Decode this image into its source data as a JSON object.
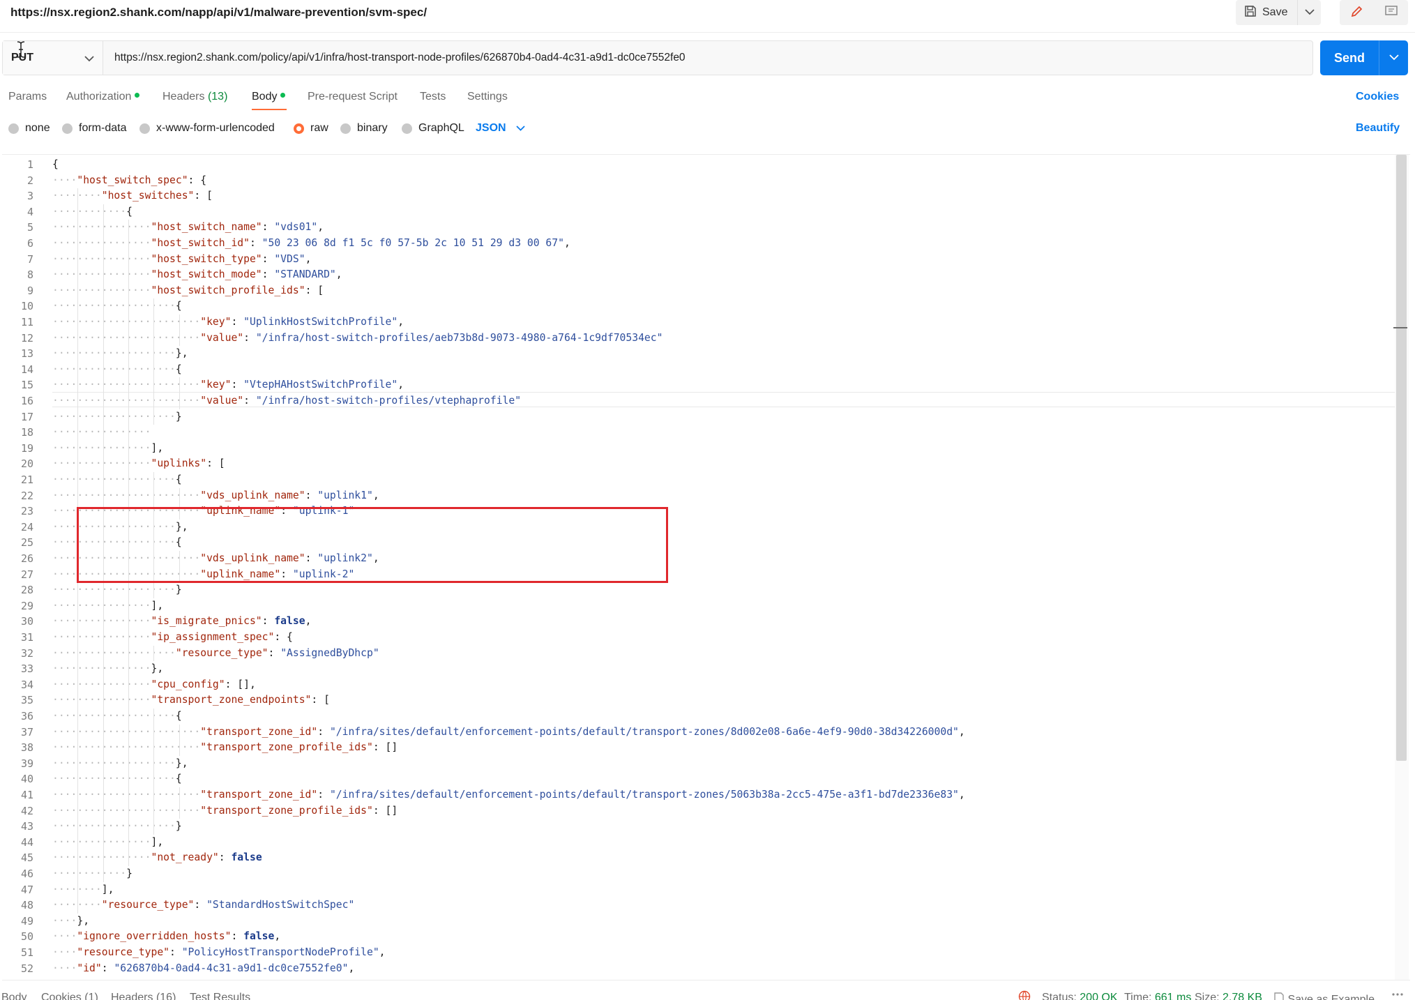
{
  "window": {
    "request_title": "https://nsx.region2.shank.com/napp/api/v1/malware-prevention/svm-spec/",
    "save_label": "Save"
  },
  "request": {
    "method": "PUT",
    "url": "https://nsx.region2.shank.com/policy/api/v1/infra/host-transport-node-profiles/626870b4-0ad4-4c31-a9d1-dc0ce7552fe0",
    "send_label": "Send"
  },
  "tabs": [
    {
      "label": "Params",
      "count": "",
      "dot": false,
      "active": false
    },
    {
      "label": "Authorization",
      "count": "",
      "dot": true,
      "active": false
    },
    {
      "label": "Headers",
      "count": "(13)",
      "dot": false,
      "active": false
    },
    {
      "label": "Body",
      "count": "",
      "dot": true,
      "active": true
    },
    {
      "label": "Pre-request Script",
      "count": "",
      "dot": false,
      "active": false
    },
    {
      "label": "Tests",
      "count": "",
      "dot": false,
      "active": false
    },
    {
      "label": "Settings",
      "count": "",
      "dot": false,
      "active": false
    }
  ],
  "cookies_label": "Cookies",
  "body_types": [
    {
      "label": "none",
      "selected": false
    },
    {
      "label": "form-data",
      "selected": false
    },
    {
      "label": "x-www-form-urlencoded",
      "selected": false
    },
    {
      "label": "raw",
      "selected": true
    },
    {
      "label": "binary",
      "selected": false
    },
    {
      "label": "GraphQL",
      "selected": false
    }
  ],
  "language_label": "JSON",
  "beautify_label": "Beautify",
  "editor": {
    "lines": [
      {
        "indent": 0,
        "tokens": [
          [
            "p",
            "{"
          ]
        ]
      },
      {
        "indent": 1,
        "tokens": [
          [
            "k",
            "\"host_switch_spec\""
          ],
          [
            "p",
            ": {"
          ]
        ]
      },
      {
        "indent": 2,
        "tokens": [
          [
            "k",
            "\"host_switches\""
          ],
          [
            "p",
            ": ["
          ]
        ]
      },
      {
        "indent": 3,
        "tokens": [
          [
            "p",
            "{"
          ]
        ]
      },
      {
        "indent": 4,
        "tokens": [
          [
            "k",
            "\"host_switch_name\""
          ],
          [
            "p",
            ": "
          ],
          [
            "s",
            "\"vds01\""
          ],
          [
            "p",
            ","
          ]
        ]
      },
      {
        "indent": 4,
        "tokens": [
          [
            "k",
            "\"host_switch_id\""
          ],
          [
            "p",
            ": "
          ],
          [
            "s",
            "\"50 23 06 8d f1 5c f0 57-5b 2c 10 51 29 d3 00 67\""
          ],
          [
            "p",
            ","
          ]
        ]
      },
      {
        "indent": 4,
        "tokens": [
          [
            "k",
            "\"host_switch_type\""
          ],
          [
            "p",
            ": "
          ],
          [
            "s",
            "\"VDS\""
          ],
          [
            "p",
            ","
          ]
        ]
      },
      {
        "indent": 4,
        "tokens": [
          [
            "k",
            "\"host_switch_mode\""
          ],
          [
            "p",
            ": "
          ],
          [
            "s",
            "\"STANDARD\""
          ],
          [
            "p",
            ","
          ]
        ]
      },
      {
        "indent": 4,
        "tokens": [
          [
            "k",
            "\"host_switch_profile_ids\""
          ],
          [
            "p",
            ": ["
          ]
        ]
      },
      {
        "indent": 5,
        "tokens": [
          [
            "p",
            "{"
          ]
        ]
      },
      {
        "indent": 6,
        "tokens": [
          [
            "k",
            "\"key\""
          ],
          [
            "p",
            ": "
          ],
          [
            "s",
            "\"UplinkHostSwitchProfile\""
          ],
          [
            "p",
            ","
          ]
        ]
      },
      {
        "indent": 6,
        "tokens": [
          [
            "k",
            "\"value\""
          ],
          [
            "p",
            ": "
          ],
          [
            "s",
            "\"/infra/host-switch-profiles/aeb73b8d-9073-4980-a764-1c9df70534ec\""
          ]
        ]
      },
      {
        "indent": 5,
        "tokens": [
          [
            "p",
            "},"
          ]
        ]
      },
      {
        "indent": 5,
        "tokens": [
          [
            "p",
            "{"
          ]
        ]
      },
      {
        "indent": 6,
        "tokens": [
          [
            "k",
            "\"key\""
          ],
          [
            "p",
            ": "
          ],
          [
            "s",
            "\"VtepHAHostSwitchProfile\""
          ],
          [
            "p",
            ","
          ]
        ]
      },
      {
        "indent": 6,
        "tokens": [
          [
            "k",
            "\"value\""
          ],
          [
            "p",
            ": "
          ],
          [
            "s",
            "\"/infra/host-switch-profiles/vtephaprofile\""
          ]
        ]
      },
      {
        "indent": 5,
        "tokens": [
          [
            "p",
            "}"
          ]
        ]
      },
      {
        "indent": 4,
        "tokens": []
      },
      {
        "indent": 4,
        "tokens": [
          [
            "p",
            "],"
          ]
        ]
      },
      {
        "indent": 4,
        "tokens": [
          [
            "k",
            "\"uplinks\""
          ],
          [
            "p",
            ": ["
          ]
        ]
      },
      {
        "indent": 5,
        "tokens": [
          [
            "p",
            "{"
          ]
        ]
      },
      {
        "indent": 6,
        "tokens": [
          [
            "k",
            "\"vds_uplink_name\""
          ],
          [
            "p",
            ": "
          ],
          [
            "s",
            "\"uplink1\""
          ],
          [
            "p",
            ","
          ]
        ]
      },
      {
        "indent": 6,
        "tokens": [
          [
            "k",
            "\"uplink_name\""
          ],
          [
            "p",
            ": "
          ],
          [
            "s",
            "\"uplink-1\""
          ]
        ]
      },
      {
        "indent": 5,
        "tokens": [
          [
            "p",
            "},"
          ]
        ]
      },
      {
        "indent": 5,
        "tokens": [
          [
            "p",
            "{"
          ]
        ]
      },
      {
        "indent": 6,
        "tokens": [
          [
            "k",
            "\"vds_uplink_name\""
          ],
          [
            "p",
            ": "
          ],
          [
            "s",
            "\"uplink2\""
          ],
          [
            "p",
            ","
          ]
        ]
      },
      {
        "indent": 6,
        "tokens": [
          [
            "k",
            "\"uplink_name\""
          ],
          [
            "p",
            ": "
          ],
          [
            "s",
            "\"uplink-2\""
          ]
        ]
      },
      {
        "indent": 5,
        "tokens": [
          [
            "p",
            "}"
          ]
        ]
      },
      {
        "indent": 4,
        "tokens": [
          [
            "p",
            "],"
          ]
        ]
      },
      {
        "indent": 4,
        "tokens": [
          [
            "k",
            "\"is_migrate_pnics\""
          ],
          [
            "p",
            ": "
          ],
          [
            "b",
            "false"
          ],
          [
            "p",
            ","
          ]
        ]
      },
      {
        "indent": 4,
        "tokens": [
          [
            "k",
            "\"ip_assignment_spec\""
          ],
          [
            "p",
            ": {"
          ]
        ]
      },
      {
        "indent": 5,
        "tokens": [
          [
            "k",
            "\"resource_type\""
          ],
          [
            "p",
            ": "
          ],
          [
            "s",
            "\"AssignedByDhcp\""
          ]
        ]
      },
      {
        "indent": 4,
        "tokens": [
          [
            "p",
            "},"
          ]
        ]
      },
      {
        "indent": 4,
        "tokens": [
          [
            "k",
            "\"cpu_config\""
          ],
          [
            "p",
            ": [],"
          ]
        ]
      },
      {
        "indent": 4,
        "tokens": [
          [
            "k",
            "\"transport_zone_endpoints\""
          ],
          [
            "p",
            ": ["
          ]
        ]
      },
      {
        "indent": 5,
        "tokens": [
          [
            "p",
            "{"
          ]
        ]
      },
      {
        "indent": 6,
        "tokens": [
          [
            "k",
            "\"transport_zone_id\""
          ],
          [
            "p",
            ": "
          ],
          [
            "s",
            "\"/infra/sites/default/enforcement-points/default/transport-zones/8d002e08-6a6e-4ef9-90d0-38d34226000d\""
          ],
          [
            "p",
            ","
          ]
        ]
      },
      {
        "indent": 6,
        "tokens": [
          [
            "k",
            "\"transport_zone_profile_ids\""
          ],
          [
            "p",
            ": []"
          ]
        ]
      },
      {
        "indent": 5,
        "tokens": [
          [
            "p",
            "},"
          ]
        ]
      },
      {
        "indent": 5,
        "tokens": [
          [
            "p",
            "{"
          ]
        ]
      },
      {
        "indent": 6,
        "tokens": [
          [
            "k",
            "\"transport_zone_id\""
          ],
          [
            "p",
            ": "
          ],
          [
            "s",
            "\"/infra/sites/default/enforcement-points/default/transport-zones/5063b38a-2cc5-475e-a3f1-bd7de2336e83\""
          ],
          [
            "p",
            ","
          ]
        ]
      },
      {
        "indent": 6,
        "tokens": [
          [
            "k",
            "\"transport_zone_profile_ids\""
          ],
          [
            "p",
            ": []"
          ]
        ]
      },
      {
        "indent": 5,
        "tokens": [
          [
            "p",
            "}"
          ]
        ]
      },
      {
        "indent": 4,
        "tokens": [
          [
            "p",
            "],"
          ]
        ]
      },
      {
        "indent": 4,
        "tokens": [
          [
            "k",
            "\"not_ready\""
          ],
          [
            "p",
            ": "
          ],
          [
            "b",
            "false"
          ]
        ]
      },
      {
        "indent": 3,
        "tokens": [
          [
            "p",
            "}"
          ]
        ]
      },
      {
        "indent": 2,
        "tokens": [
          [
            "p",
            "],"
          ]
        ]
      },
      {
        "indent": 2,
        "tokens": [
          [
            "k",
            "\"resource_type\""
          ],
          [
            "p",
            ": "
          ],
          [
            "s",
            "\"StandardHostSwitchSpec\""
          ]
        ]
      },
      {
        "indent": 1,
        "tokens": [
          [
            "p",
            "},"
          ]
        ]
      },
      {
        "indent": 1,
        "tokens": [
          [
            "k",
            "\"ignore_overridden_hosts\""
          ],
          [
            "p",
            ": "
          ],
          [
            "b",
            "false"
          ],
          [
            "p",
            ","
          ]
        ]
      },
      {
        "indent": 1,
        "tokens": [
          [
            "k",
            "\"resource_type\""
          ],
          [
            "p",
            ": "
          ],
          [
            "s",
            "\"PolicyHostTransportNodeProfile\""
          ],
          [
            "p",
            ","
          ]
        ]
      },
      {
        "indent": 1,
        "tokens": [
          [
            "k",
            "\"id\""
          ],
          [
            "p",
            ": "
          ],
          [
            "s",
            "\"626870b4-0ad4-4c31-a9d1-dc0ce7552fe0\""
          ],
          [
            "p",
            ","
          ]
        ]
      }
    ]
  },
  "response_tabs": [
    {
      "label": "Body",
      "count": ""
    },
    {
      "label": "Cookies",
      "count": "(1)"
    },
    {
      "label": "Headers",
      "count": "(16)"
    },
    {
      "label": "Test Results",
      "count": ""
    }
  ],
  "response_status": {
    "status_label": "Status:",
    "status_value": "200 OK",
    "time_label": "Time:",
    "time_value": "661 ms",
    "size_label": "Size:",
    "size_value": "2.78 KB",
    "save_example_label": "Save as Example"
  },
  "icons": [
    "save-icon",
    "chevron-down-icon",
    "edit-icon",
    "comment-icon",
    "globe-icon",
    "more-icon"
  ],
  "colors": {
    "accent": "#097bed",
    "active_tab": "#ff6c37",
    "status_ok": "#0c8a3c",
    "highlight_box": "#e0282d"
  }
}
